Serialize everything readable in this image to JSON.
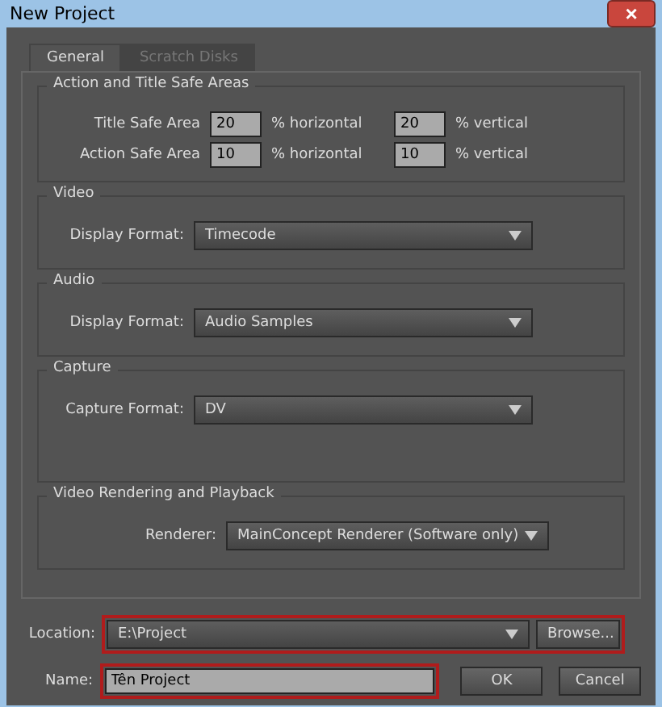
{
  "window": {
    "title": "New Project",
    "close": "×"
  },
  "tabs": [
    {
      "label": "General",
      "selected": true
    },
    {
      "label": "Scratch Disks",
      "selected": false
    }
  ],
  "safe_areas": {
    "title": "Action and Title Safe Areas",
    "rows": [
      {
        "label": "Title Safe Area",
        "horizontal": "20",
        "horizontal_unit": "% horizontal",
        "vertical": "20",
        "vertical_unit": "% vertical"
      },
      {
        "label": "Action Safe Area",
        "horizontal": "10",
        "horizontal_unit": "% horizontal",
        "vertical": "10",
        "vertical_unit": "% vertical"
      }
    ]
  },
  "sections": [
    {
      "title": "Video",
      "label": "Display Format:",
      "value": "Timecode"
    },
    {
      "title": "Audio",
      "label": "Display Format:",
      "value": "Audio Samples"
    },
    {
      "title": "Capture",
      "label": "Capture Format:",
      "value": "DV"
    },
    {
      "title": "Video Rendering and Playback",
      "label": "Renderer:",
      "value": "MainConcept Renderer (Software only)"
    }
  ],
  "location": {
    "label": "Location:",
    "value": "E:\\Project",
    "browse": "Browse...",
    "highlighted": true
  },
  "name": {
    "label": "Name:",
    "value": "Tên Project",
    "highlighted": true
  },
  "buttons": [
    "OK",
    "Cancel"
  ]
}
